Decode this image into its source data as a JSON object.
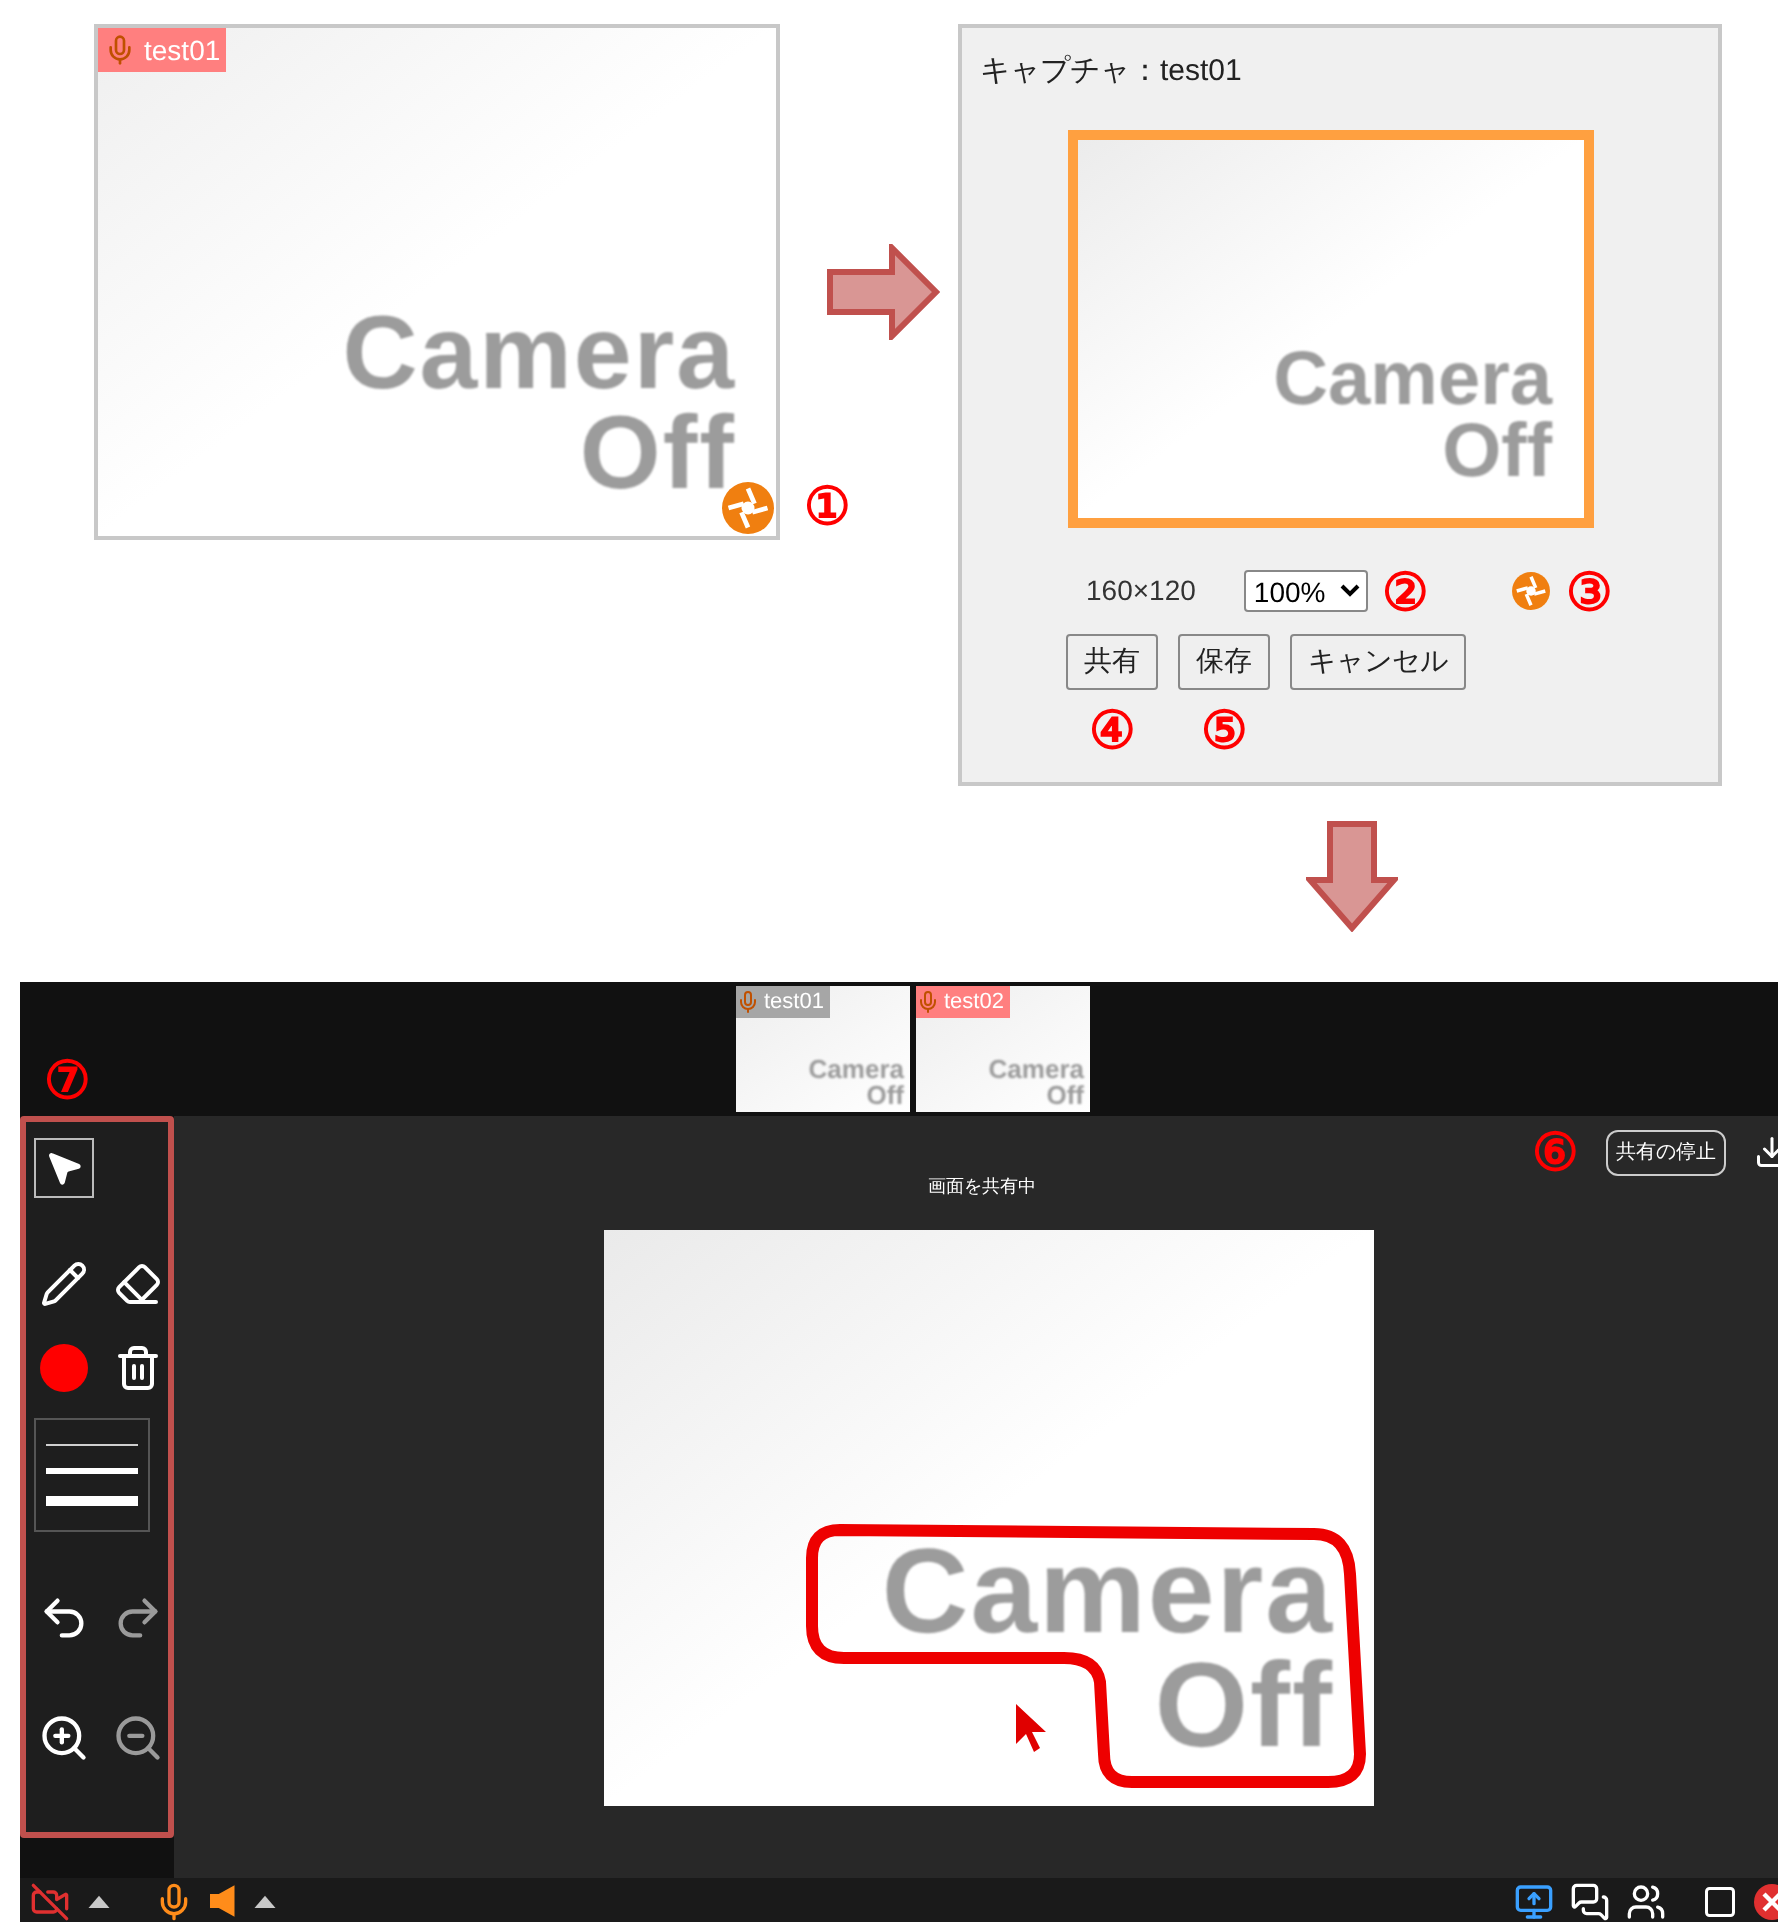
{
  "capture_source": {
    "name": "test01",
    "camera_text": [
      "Camera",
      "Off"
    ],
    "callout": "①"
  },
  "capture_dialog": {
    "title": "キャプチャ：test01",
    "camera_text": [
      "Camera",
      "Off"
    ],
    "size": "160×120",
    "zoom": "100%",
    "zoom_callout": "②",
    "capture_callout": "③",
    "buttons": [
      {
        "label": "共有",
        "callout": "④"
      },
      {
        "label": "保存",
        "callout": "⑤"
      },
      {
        "label": "キャンセル"
      }
    ]
  },
  "meeting": {
    "thumbnails": [
      {
        "name": "test01",
        "color": "#a6a6a6",
        "camera_text": [
          "Camera",
          "Off"
        ]
      },
      {
        "name": "test02",
        "color": "#ff7f7f",
        "camera_text": [
          "Camera",
          "Off"
        ]
      }
    ],
    "toolbar_callout": "⑦",
    "tools": [
      {
        "kind": "select",
        "selected": true,
        "disabled": false
      },
      {
        "kind": "pen",
        "selected": false,
        "disabled": false
      },
      {
        "kind": "eraser",
        "selected": false,
        "disabled": false
      },
      {
        "kind": "color",
        "selected": false,
        "color": "#ff0000"
      },
      {
        "kind": "clear",
        "selected": false,
        "disabled": false
      },
      {
        "kind": "line_width",
        "selected": false,
        "disabled": false
      },
      {
        "kind": "undo",
        "selected": false,
        "disabled": false
      },
      {
        "kind": "redo",
        "selected": false,
        "disabled": true
      },
      {
        "kind": "zoom_in",
        "selected": false,
        "disabled": false
      },
      {
        "kind": "zoom_out",
        "selected": false,
        "disabled": true
      }
    ],
    "stop_callout": "⑥",
    "stop_button": "共有の停止",
    "status": "画面を共有中",
    "shared_camera_text": [
      "Camera",
      "Off"
    ]
  }
}
